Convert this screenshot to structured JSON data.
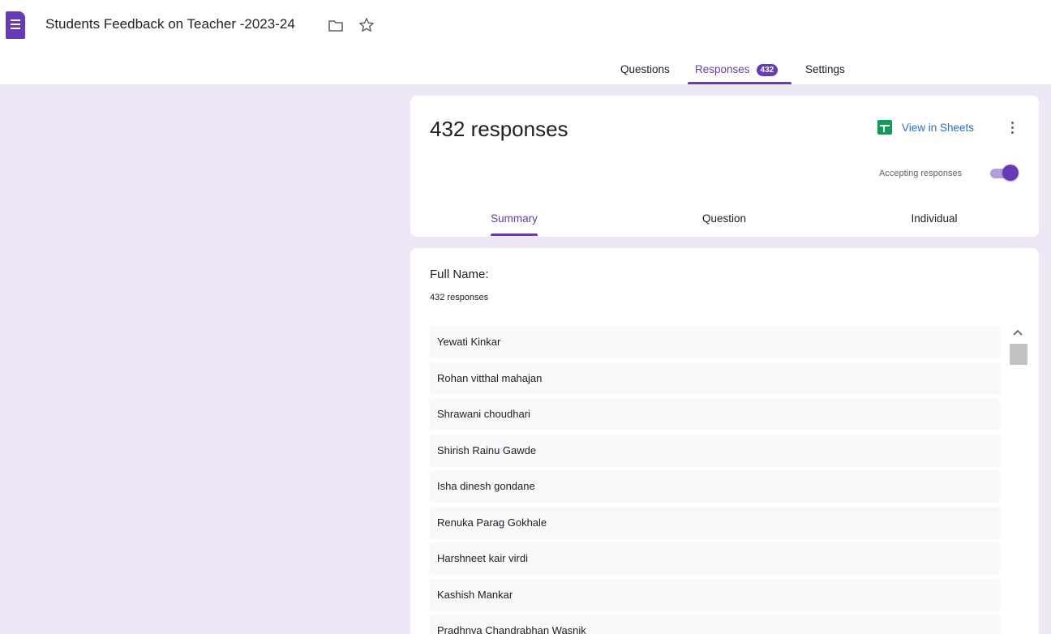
{
  "header": {
    "title": "Students Feedback on Teacher -2023-24",
    "logo_icon": "google-forms-icon",
    "folder_icon": "folder-icon",
    "star_icon": "star-icon"
  },
  "nav": {
    "tabs": [
      {
        "label": "Questions",
        "active": false
      },
      {
        "label": "Responses",
        "active": true,
        "badge": "432"
      },
      {
        "label": "Settings",
        "active": false
      }
    ]
  },
  "summary_card": {
    "count_text": "432 responses",
    "sheets_label": "View in Sheets",
    "accepting_label": "Accepting responses",
    "accepting_enabled": true,
    "tabs": [
      {
        "label": "Summary",
        "active": true
      },
      {
        "label": "Question",
        "active": false
      },
      {
        "label": "Individual",
        "active": false
      }
    ]
  },
  "question_card": {
    "title": "Full Name:",
    "count_text": "432 responses",
    "responses": [
      "Yewati Kinkar",
      "Rohan vitthal mahajan",
      "Shrawani choudhari",
      "Shirish Rainu Gawde",
      "Isha dinesh gondane",
      "Renuka Parag Gokhale",
      "Harshneet kair virdi",
      "Kashish Mankar",
      "Pradhnya Chandrabhan Wasnik"
    ]
  },
  "colors": {
    "accent": "#673ab7",
    "background": "#ede7f6",
    "link": "#1a73e8",
    "sheets_green": "#0f9d58"
  }
}
